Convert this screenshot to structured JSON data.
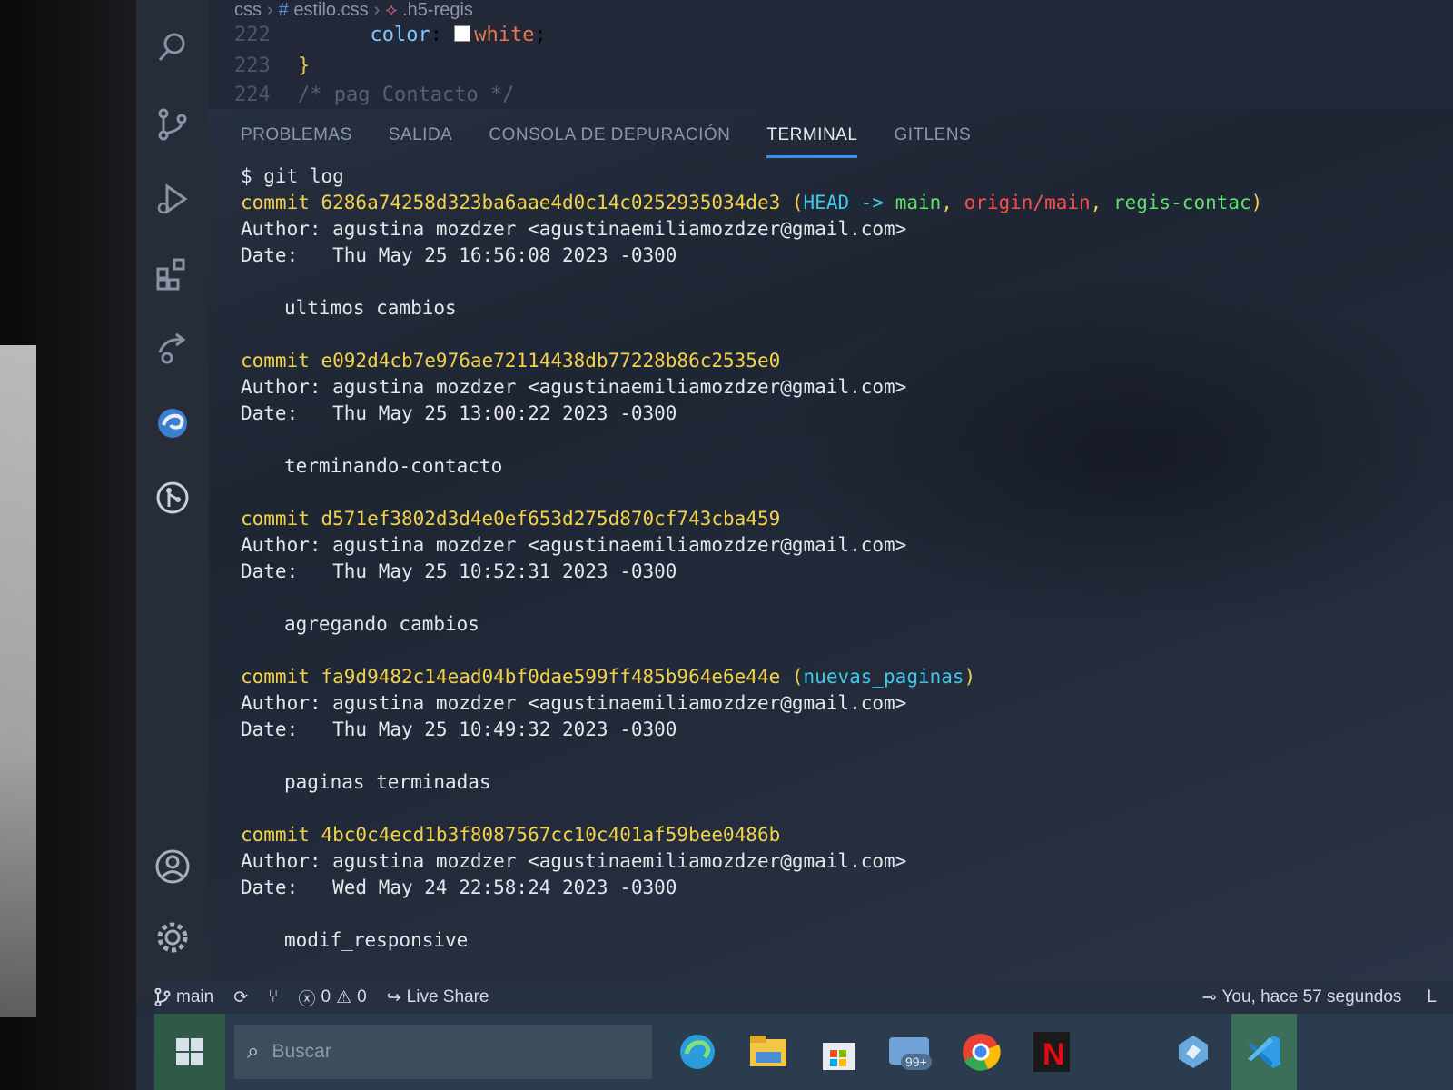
{
  "breadcrumb": {
    "folder": "css",
    "file": "estilo.css",
    "selector": ".h5-regis"
  },
  "editor_lines": [
    {
      "num": "222",
      "prop": "color",
      "value": "white"
    },
    {
      "num": "223",
      "brace": "}"
    },
    {
      "num": "224",
      "comment": "/* pag Contacto */"
    }
  ],
  "panel_tabs": [
    "PROBLEMAS",
    "SALIDA",
    "CONSOLA DE DEPURACIÓN",
    "TERMINAL",
    "GITLENS"
  ],
  "active_tab": "TERMINAL",
  "terminal": {
    "command": "$ git log",
    "commits": [
      {
        "line": "commit 6286a74258d323ba6aae4d0c14c0252935034de3",
        "refs_open": " (",
        "head": "HEAD -> ",
        "main": "main",
        "comma1": ", ",
        "origin": "origin/main",
        "comma2": ", ",
        "branch": "regis-contac",
        "refs_close": ")",
        "author": "Author: agustina mozdzer <agustinaemiliamozdzer@gmail.com>",
        "date": "Date:   Thu May 25 16:56:08 2023 -0300",
        "message": "ultimos cambios"
      },
      {
        "line": "commit e092d4cb7e976ae72114438db77228b86c2535e0",
        "author": "Author: agustina mozdzer <agustinaemiliamozdzer@gmail.com>",
        "date": "Date:   Thu May 25 13:00:22 2023 -0300",
        "message": "terminando-contacto"
      },
      {
        "line": "commit d571ef3802d3d4e0ef653d275d870cf743cba459",
        "author": "Author: agustina mozdzer <agustinaemiliamozdzer@gmail.com>",
        "date": "Date:   Thu May 25 10:52:31 2023 -0300",
        "message": "agregando cambios"
      },
      {
        "line": "commit fa9d9482c14ead04bf0dae599ff485b964e6e44e",
        "refs_open": " (",
        "branch": "nuevas_paginas",
        "refs_close": ")",
        "author": "Author: agustina mozdzer <agustinaemiliamozdzer@gmail.com>",
        "date": "Date:   Thu May 25 10:49:32 2023 -0300",
        "message": "paginas terminadas"
      },
      {
        "line": "commit 4bc0c4ecd1b3f8087567cc10c401af59bee0486b",
        "author": "Author: agustina mozdzer <agustinaemiliamozdzer@gmail.com>",
        "date": "Date:   Wed May 24 22:58:24 2023 -0300",
        "message": "modif_responsive"
      }
    ]
  },
  "statusbar": {
    "branch": "main",
    "errors": "0",
    "warnings": "0",
    "live_share": "Live Share",
    "blame": "You, hace 57 segundos",
    "extra": "L"
  },
  "taskbar": {
    "search_placeholder": "Buscar",
    "badge": "99+"
  },
  "icons": [
    "search-icon",
    "source-control-icon",
    "run-debug-icon",
    "extensions-icon",
    "remote-icon",
    "edge-devtools-icon",
    "git-graph-icon",
    "account-icon",
    "gear-icon"
  ],
  "colors": {
    "accent": "#3b8eea",
    "commit": "#f2d24a",
    "head": "#3fc8e8",
    "branch": "#5fe06a",
    "remote": "#ff4d4d"
  }
}
